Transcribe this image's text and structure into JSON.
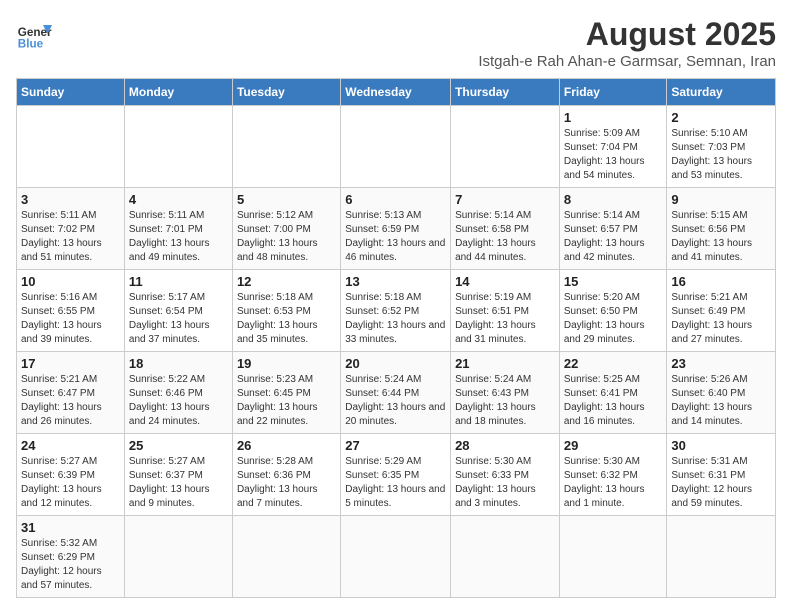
{
  "header": {
    "logo_general": "General",
    "logo_blue": "Blue",
    "main_title": "August 2025",
    "subtitle": "Istgah-e Rah Ahan-e Garmsar, Semnan, Iran"
  },
  "weekdays": [
    "Sunday",
    "Monday",
    "Tuesday",
    "Wednesday",
    "Thursday",
    "Friday",
    "Saturday"
  ],
  "weeks": [
    [
      {
        "day": "",
        "info": ""
      },
      {
        "day": "",
        "info": ""
      },
      {
        "day": "",
        "info": ""
      },
      {
        "day": "",
        "info": ""
      },
      {
        "day": "",
        "info": ""
      },
      {
        "day": "1",
        "info": "Sunrise: 5:09 AM\nSunset: 7:04 PM\nDaylight: 13 hours and 54 minutes."
      },
      {
        "day": "2",
        "info": "Sunrise: 5:10 AM\nSunset: 7:03 PM\nDaylight: 13 hours and 53 minutes."
      }
    ],
    [
      {
        "day": "3",
        "info": "Sunrise: 5:11 AM\nSunset: 7:02 PM\nDaylight: 13 hours and 51 minutes."
      },
      {
        "day": "4",
        "info": "Sunrise: 5:11 AM\nSunset: 7:01 PM\nDaylight: 13 hours and 49 minutes."
      },
      {
        "day": "5",
        "info": "Sunrise: 5:12 AM\nSunset: 7:00 PM\nDaylight: 13 hours and 48 minutes."
      },
      {
        "day": "6",
        "info": "Sunrise: 5:13 AM\nSunset: 6:59 PM\nDaylight: 13 hours and 46 minutes."
      },
      {
        "day": "7",
        "info": "Sunrise: 5:14 AM\nSunset: 6:58 PM\nDaylight: 13 hours and 44 minutes."
      },
      {
        "day": "8",
        "info": "Sunrise: 5:14 AM\nSunset: 6:57 PM\nDaylight: 13 hours and 42 minutes."
      },
      {
        "day": "9",
        "info": "Sunrise: 5:15 AM\nSunset: 6:56 PM\nDaylight: 13 hours and 41 minutes."
      }
    ],
    [
      {
        "day": "10",
        "info": "Sunrise: 5:16 AM\nSunset: 6:55 PM\nDaylight: 13 hours and 39 minutes."
      },
      {
        "day": "11",
        "info": "Sunrise: 5:17 AM\nSunset: 6:54 PM\nDaylight: 13 hours and 37 minutes."
      },
      {
        "day": "12",
        "info": "Sunrise: 5:18 AM\nSunset: 6:53 PM\nDaylight: 13 hours and 35 minutes."
      },
      {
        "day": "13",
        "info": "Sunrise: 5:18 AM\nSunset: 6:52 PM\nDaylight: 13 hours and 33 minutes."
      },
      {
        "day": "14",
        "info": "Sunrise: 5:19 AM\nSunset: 6:51 PM\nDaylight: 13 hours and 31 minutes."
      },
      {
        "day": "15",
        "info": "Sunrise: 5:20 AM\nSunset: 6:50 PM\nDaylight: 13 hours and 29 minutes."
      },
      {
        "day": "16",
        "info": "Sunrise: 5:21 AM\nSunset: 6:49 PM\nDaylight: 13 hours and 27 minutes."
      }
    ],
    [
      {
        "day": "17",
        "info": "Sunrise: 5:21 AM\nSunset: 6:47 PM\nDaylight: 13 hours and 26 minutes."
      },
      {
        "day": "18",
        "info": "Sunrise: 5:22 AM\nSunset: 6:46 PM\nDaylight: 13 hours and 24 minutes."
      },
      {
        "day": "19",
        "info": "Sunrise: 5:23 AM\nSunset: 6:45 PM\nDaylight: 13 hours and 22 minutes."
      },
      {
        "day": "20",
        "info": "Sunrise: 5:24 AM\nSunset: 6:44 PM\nDaylight: 13 hours and 20 minutes."
      },
      {
        "day": "21",
        "info": "Sunrise: 5:24 AM\nSunset: 6:43 PM\nDaylight: 13 hours and 18 minutes."
      },
      {
        "day": "22",
        "info": "Sunrise: 5:25 AM\nSunset: 6:41 PM\nDaylight: 13 hours and 16 minutes."
      },
      {
        "day": "23",
        "info": "Sunrise: 5:26 AM\nSunset: 6:40 PM\nDaylight: 13 hours and 14 minutes."
      }
    ],
    [
      {
        "day": "24",
        "info": "Sunrise: 5:27 AM\nSunset: 6:39 PM\nDaylight: 13 hours and 12 minutes."
      },
      {
        "day": "25",
        "info": "Sunrise: 5:27 AM\nSunset: 6:37 PM\nDaylight: 13 hours and 9 minutes."
      },
      {
        "day": "26",
        "info": "Sunrise: 5:28 AM\nSunset: 6:36 PM\nDaylight: 13 hours and 7 minutes."
      },
      {
        "day": "27",
        "info": "Sunrise: 5:29 AM\nSunset: 6:35 PM\nDaylight: 13 hours and 5 minutes."
      },
      {
        "day": "28",
        "info": "Sunrise: 5:30 AM\nSunset: 6:33 PM\nDaylight: 13 hours and 3 minutes."
      },
      {
        "day": "29",
        "info": "Sunrise: 5:30 AM\nSunset: 6:32 PM\nDaylight: 13 hours and 1 minute."
      },
      {
        "day": "30",
        "info": "Sunrise: 5:31 AM\nSunset: 6:31 PM\nDaylight: 12 hours and 59 minutes."
      }
    ],
    [
      {
        "day": "31",
        "info": "Sunrise: 5:32 AM\nSunset: 6:29 PM\nDaylight: 12 hours and 57 minutes."
      },
      {
        "day": "",
        "info": ""
      },
      {
        "day": "",
        "info": ""
      },
      {
        "day": "",
        "info": ""
      },
      {
        "day": "",
        "info": ""
      },
      {
        "day": "",
        "info": ""
      },
      {
        "day": "",
        "info": ""
      }
    ]
  ]
}
